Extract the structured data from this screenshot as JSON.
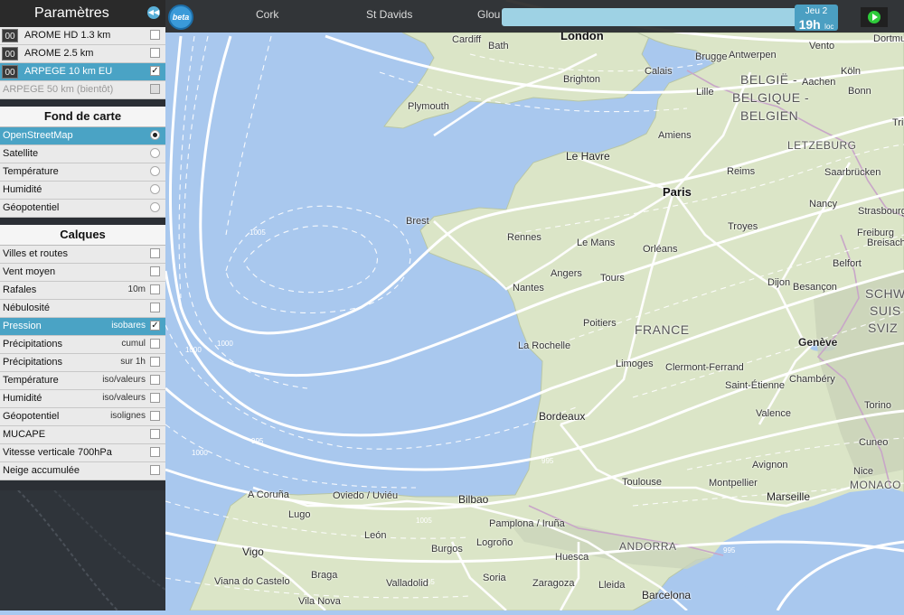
{
  "app": {
    "logo_text": "beta"
  },
  "panel": {
    "title": "Paramètres",
    "collapse_icon": "double-chevron-left-icon",
    "models": [
      {
        "run": "00",
        "label": "AROME HD 1.3 km",
        "checked": false
      },
      {
        "run": "00",
        "label": "AROME 2.5 km",
        "checked": false
      },
      {
        "run": "00",
        "label": "ARPEGE 10 km EU",
        "checked": true
      },
      {
        "label": "ARPEGE 50 km (bientôt)",
        "checked": false
      }
    ],
    "basemap_title": "Fond de carte",
    "basemaps": [
      {
        "label": "OpenStreetMap",
        "selected": true
      },
      {
        "label": "Satellite",
        "selected": false
      },
      {
        "label": "Température",
        "selected": false
      },
      {
        "label": "Humidité",
        "selected": false
      },
      {
        "label": "Géopotentiel",
        "selected": false
      }
    ],
    "layers_title": "Calques",
    "layers": [
      {
        "label": "Villes et routes",
        "extra": "",
        "checked": false
      },
      {
        "label": "Vent moyen",
        "extra": "",
        "checked": false
      },
      {
        "label": "Rafales",
        "extra": "10m",
        "checked": false
      },
      {
        "label": "Nébulosité",
        "extra": "",
        "checked": false
      },
      {
        "label": "Pression",
        "extra": "isobares",
        "checked": true
      },
      {
        "label": "Précipitations",
        "extra": "cumul",
        "checked": false
      },
      {
        "label": "Précipitations",
        "extra": "sur 1h",
        "checked": false
      },
      {
        "label": "Température",
        "extra": "iso/valeurs",
        "checked": false
      },
      {
        "label": "Humidité",
        "extra": "iso/valeurs",
        "checked": false
      },
      {
        "label": "Géopotentiel",
        "extra": "isolignes",
        "checked": false
      },
      {
        "label": "MUCAPE",
        "extra": "",
        "checked": false
      },
      {
        "label": "Vitesse verticale 700hPa",
        "extra": "",
        "checked": false
      },
      {
        "label": "Neige accumulée",
        "extra": "",
        "checked": false
      }
    ]
  },
  "timebar": {
    "day": "Jeu 2",
    "hour": "19h",
    "suffix": "loc",
    "progress": 0.98,
    "play_icon": "play-icon"
  },
  "top_cities": [
    "Cork",
    "St Davids",
    "Glou"
  ],
  "map": {
    "countries": [
      "BELGIË -",
      "BELGIQUE -",
      "BELGIEN",
      "LETZEBURG",
      "FRANCE",
      "SCHW",
      "SUIS",
      "SVIZ",
      "ANDORRA",
      "MONACO"
    ],
    "cities": [
      "Cardiff",
      "Bath",
      "London",
      "Dortmund",
      "Vento",
      "Brighton",
      "Calais",
      "Brugge",
      "Antwerpen",
      "Köln",
      "Plymouth",
      "Lille",
      "Aachen",
      "Bonn",
      "Trier",
      "Amiens",
      "Le Havre",
      "Reims",
      "Saarbrücken",
      "Paris",
      "Nancy",
      "Strasbourg",
      "Brest",
      "Rennes",
      "Le Mans",
      "Orléans",
      "Troyes",
      "Freiburg",
      "Breisach",
      "Angers",
      "Tours",
      "Nantes",
      "Belfort",
      "Dijon",
      "Besançon",
      "Poitiers",
      "La Rochelle",
      "Genève",
      "Limoges",
      "Clermont-Ferrand",
      "Chambéry",
      "Saint-Étienne",
      "Torino",
      "Bordeaux",
      "Valence",
      "Cuneo",
      "Toulouse",
      "Avignon",
      "Montpellier",
      "Marseille",
      "Nice",
      "A Coruña",
      "Oviedo / Uviéu",
      "Bilbao",
      "Lugo",
      "Pamplona / Iruña",
      "León",
      "Logroño",
      "Burgos",
      "Huesca",
      "Vigo",
      "Braga",
      "Soria",
      "Zaragoza",
      "Lleida",
      "Barcelona",
      "Viana do Castelo",
      "Valladolid",
      "Vila Nova"
    ],
    "isobar_values": [
      "995",
      "995",
      "1000",
      "1000",
      "1000",
      "1005",
      "1005",
      "1005",
      "995"
    ]
  }
}
